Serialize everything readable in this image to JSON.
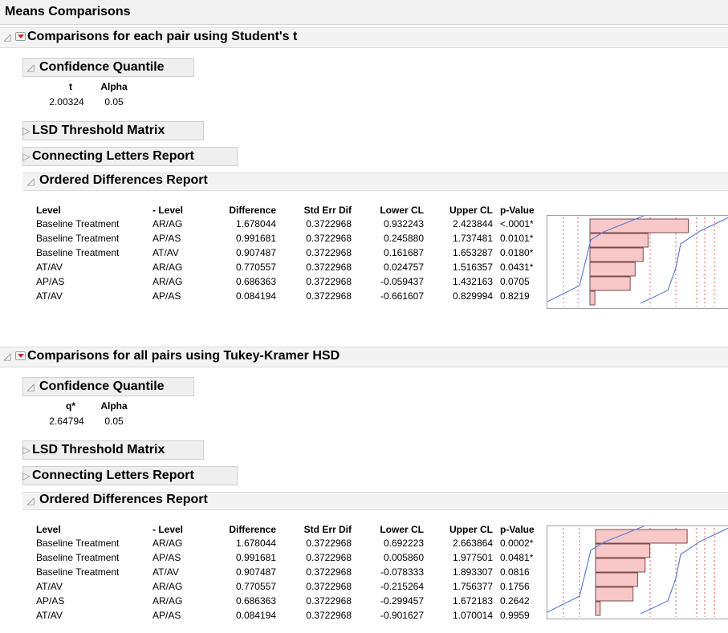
{
  "title": "Means Comparisons",
  "colors": {
    "bar_fill": "#f8c8c8",
    "bar_stroke": "#7a4a4a",
    "line": "#5b7fd9",
    "ref_line": "#e06060",
    "menu_arrow": "#d42020"
  },
  "icons": {
    "expanded": "triangle-down-icon",
    "collapsed": "triangle-right-icon",
    "menu": "red-menu-icon"
  },
  "sections": [
    {
      "title": "Comparisons for each pair using Student's t",
      "cq": {
        "title": "Confidence Quantile",
        "col1_header": "t",
        "col2_header": "Alpha",
        "col1_value": "2.00324",
        "col2_value": "0.05"
      },
      "lsd_title": "LSD Threshold Matrix",
      "letters_title": "Connecting Letters Report",
      "od": {
        "title": "Ordered Differences Report",
        "headers": [
          "Level",
          "- Level",
          "Difference",
          "Std Err Dif",
          "Lower CL",
          "Upper CL",
          "p-Value"
        ],
        "rows": [
          [
            "Baseline Treatment",
            "AR/AG",
            "1.678044",
            "0.3722968",
            "0.932243",
            "2.423844",
            "<.0001*"
          ],
          [
            "Baseline Treatment",
            "AP/AS",
            "0.991681",
            "0.3722968",
            "0.245880",
            "1.737481",
            "0.0101*"
          ],
          [
            "Baseline Treatment",
            "AT/AV",
            "0.907487",
            "0.3722968",
            "0.161687",
            "1.653287",
            "0.0180*"
          ],
          [
            "AT/AV",
            "AR/AG",
            "0.770557",
            "0.3722968",
            "0.024757",
            "1.516357",
            "0.0431*"
          ],
          [
            "AP/AS",
            "AR/AG",
            "0.686363",
            "0.3722968",
            "-0.059437",
            "1.432163",
            "0.0705"
          ],
          [
            "AT/AV",
            "AP/AS",
            "0.084194",
            "0.3722968",
            "-0.661607",
            "0.829994",
            "0.8219"
          ]
        ],
        "differences": [
          1.678044,
          0.991681,
          0.907487,
          0.770557,
          0.686363,
          0.084194
        ]
      }
    },
    {
      "title": "Comparisons for all pairs using Tukey-Kramer HSD",
      "cq": {
        "title": "Confidence Quantile",
        "col1_header": "q*",
        "col2_header": "Alpha",
        "col1_value": "2.64794",
        "col2_value": "0.05"
      },
      "lsd_title": "LSD Threshold Matrix",
      "letters_title": "Connecting Letters Report",
      "od": {
        "title": "Ordered Differences Report",
        "headers": [
          "Level",
          "- Level",
          "Difference",
          "Std Err Dif",
          "Lower CL",
          "Upper CL",
          "p-Value"
        ],
        "rows": [
          [
            "Baseline Treatment",
            "AR/AG",
            "1.678044",
            "0.3722968",
            "0.692223",
            "2.663864",
            "0.0002*"
          ],
          [
            "Baseline Treatment",
            "AP/AS",
            "0.991681",
            "0.3722968",
            "0.005860",
            "1.977501",
            "0.0481*"
          ],
          [
            "Baseline Treatment",
            "AT/AV",
            "0.907487",
            "0.3722968",
            "-0.078333",
            "1.893307",
            "0.0816"
          ],
          [
            "AT/AV",
            "AR/AG",
            "0.770557",
            "0.3722968",
            "-0.215264",
            "1.756377",
            "0.1756"
          ],
          [
            "AP/AS",
            "AR/AG",
            "0.686363",
            "0.3722968",
            "-0.299457",
            "1.672183",
            "0.2642"
          ],
          [
            "AT/AV",
            "AP/AS",
            "0.084194",
            "0.3722968",
            "-0.901627",
            "1.070014",
            "0.9959"
          ]
        ],
        "differences": [
          1.678044,
          0.991681,
          0.907487,
          0.770557,
          0.686363,
          0.084194
        ]
      }
    }
  ]
}
